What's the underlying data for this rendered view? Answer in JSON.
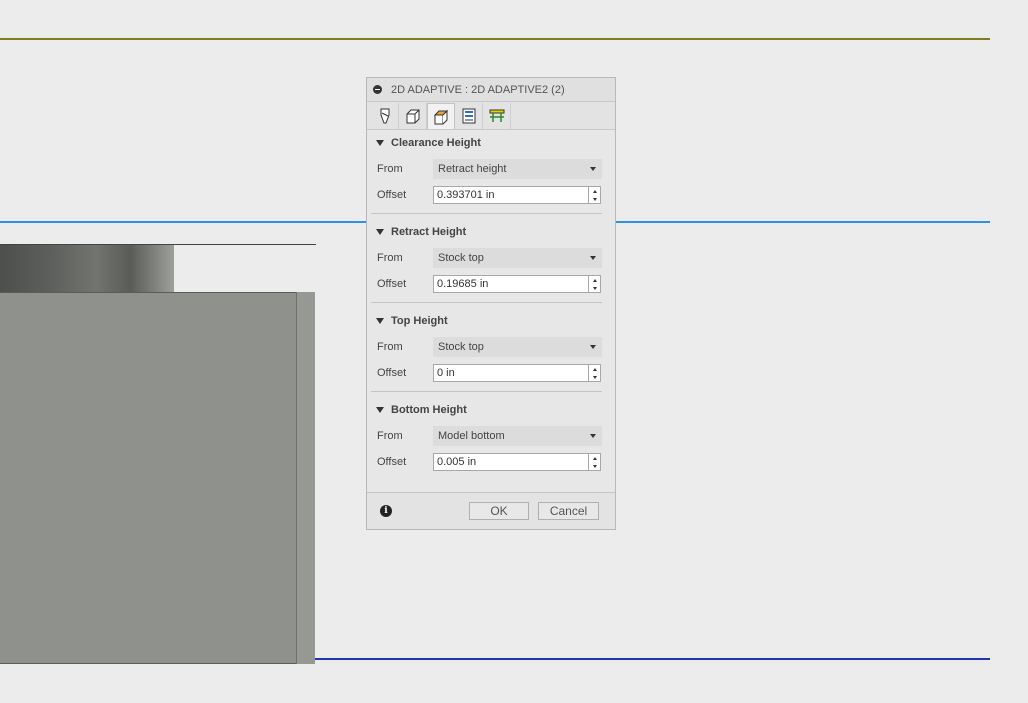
{
  "dialog": {
    "title": "2D ADAPTIVE : 2D ADAPTIVE2 (2)",
    "tabs": [
      {
        "icon": "tool-icon",
        "active": false
      },
      {
        "icon": "geometry-icon",
        "active": false
      },
      {
        "icon": "heights-icon",
        "active": true
      },
      {
        "icon": "passes-icon",
        "active": false
      },
      {
        "icon": "linking-icon",
        "active": false
      }
    ],
    "sections": [
      {
        "title": "Clearance Height",
        "from_label": "From",
        "from_value": "Retract height",
        "offset_label": "Offset",
        "offset_value": "0.393701 in"
      },
      {
        "title": "Retract Height",
        "from_label": "From",
        "from_value": "Stock top",
        "offset_label": "Offset",
        "offset_value": "0.19685 in"
      },
      {
        "title": "Top Height",
        "from_label": "From",
        "from_value": "Stock top",
        "offset_label": "Offset",
        "offset_value": "0 in"
      },
      {
        "title": "Bottom Height",
        "from_label": "From",
        "from_value": "Model bottom",
        "offset_label": "Offset",
        "offset_value": "0.005 in"
      }
    ],
    "ok_label": "OK",
    "cancel_label": "Cancel",
    "info_glyph": "i"
  },
  "colors": {
    "clearance_line": "#7d7d22",
    "retract_line": "#2e93e8",
    "bottom_line": "#2233bb",
    "active_tab_accent": "#f0a030"
  }
}
